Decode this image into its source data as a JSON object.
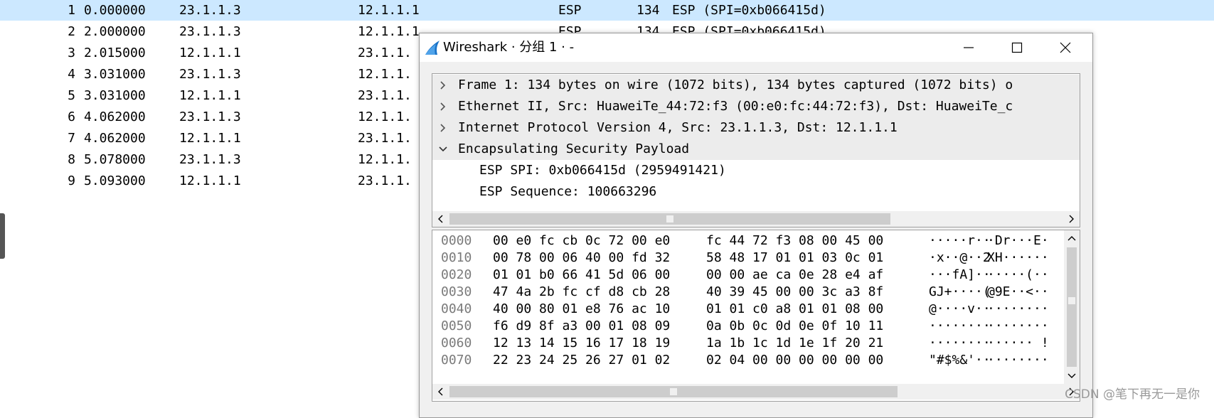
{
  "packets": [
    {
      "no": "1",
      "time": "0.000000",
      "src": "23.1.1.3",
      "dst": "12.1.1.1",
      "proto": "ESP",
      "len": "134",
      "info": "ESP (SPI=0xb066415d)"
    },
    {
      "no": "2",
      "time": "2.000000",
      "src": "23.1.1.3",
      "dst": "12.1.1.1",
      "proto": "ESP",
      "len": "134",
      "info": "ESP (SPI=0xb066415d)"
    },
    {
      "no": "3",
      "time": "2.015000",
      "src": "12.1.1.1",
      "dst": "23.1.1."
    },
    {
      "no": "4",
      "time": "3.031000",
      "src": "23.1.1.3",
      "dst": "12.1.1."
    },
    {
      "no": "5",
      "time": "3.031000",
      "src": "12.1.1.1",
      "dst": "23.1.1."
    },
    {
      "no": "6",
      "time": "4.062000",
      "src": "23.1.1.3",
      "dst": "12.1.1."
    },
    {
      "no": "7",
      "time": "4.062000",
      "src": "12.1.1.1",
      "dst": "23.1.1."
    },
    {
      "no": "8",
      "time": "5.078000",
      "src": "23.1.1.3",
      "dst": "12.1.1."
    },
    {
      "no": "9",
      "time": "5.093000",
      "src": "12.1.1.1",
      "dst": "23.1.1."
    }
  ],
  "dialog": {
    "title": "Wireshark · 分组 1 · -",
    "tree": [
      {
        "text": "Frame 1: 134 bytes on wire (1072 bits), 134 bytes captured (1072 bits) o",
        "expanded": false
      },
      {
        "text": "Ethernet II, Src: HuaweiTe_44:72:f3 (00:e0:fc:44:72:f3), Dst: HuaweiTe_c",
        "expanded": false
      },
      {
        "text": "Internet Protocol Version 4, Src: 23.1.1.3, Dst: 12.1.1.1",
        "expanded": false
      },
      {
        "text": "Encapsulating Security Payload",
        "expanded": true
      },
      {
        "text": "ESP SPI: 0xb066415d (2959491421)",
        "child": true
      },
      {
        "text": "ESP Sequence: 100663296",
        "child": true
      }
    ],
    "hex": [
      {
        "off": "0000",
        "b1": "00 e0 fc cb 0c 72 00 e0",
        "b2": "fc 44 72 f3 08 00 45 00",
        "a1": "·····r··",
        "a2": "·Dr···E·"
      },
      {
        "off": "0010",
        "b1": "00 78 00 06 40 00 fd 32",
        "b2": "58 48 17 01 01 03 0c 01",
        "a1": "·x··@··2",
        "a2": "XH······"
      },
      {
        "off": "0020",
        "b1": "01 01 b0 66 41 5d 06 00",
        "b2": "00 00 ae ca 0e 28 e4 af",
        "a1": "···fA]··",
        "a2": "·····(··"
      },
      {
        "off": "0030",
        "b1": "47 4a 2b fc cf d8 cb 28",
        "b2": "40 39 45 00 00 3c a3 8f",
        "a1": "GJ+····(",
        "a2": "@9E··<··"
      },
      {
        "off": "0040",
        "b1": "40 00 80 01 e8 76 ac 10",
        "b2": "01 01 c0 a8 01 01 08 00",
        "a1": "@····v··",
        "a2": "········"
      },
      {
        "off": "0050",
        "b1": "f6 d9 8f a3 00 01 08 09",
        "b2": "0a 0b 0c 0d 0e 0f 10 11",
        "a1": "········",
        "a2": "········"
      },
      {
        "off": "0060",
        "b1": "12 13 14 15 16 17 18 19",
        "b2": "1a 1b 1c 1d 1e 1f 20 21",
        "a1": "········",
        "a2": "······ !"
      },
      {
        "off": "0070",
        "b1": "22 23 24 25 26 27 01 02",
        "b2": "02 04 00 00 00 00 00 00",
        "a1": "\"#$%&'··",
        "a2": "········"
      }
    ]
  },
  "watermark": "CSDN @笔下再无一是你",
  "colors": {
    "selected_row": "#cce8ff",
    "shark": "#1a73c8"
  },
  "icons": {
    "app": "wireshark-fin-icon",
    "min": "minimize-icon",
    "max": "maximize-icon",
    "close": "close-icon"
  }
}
